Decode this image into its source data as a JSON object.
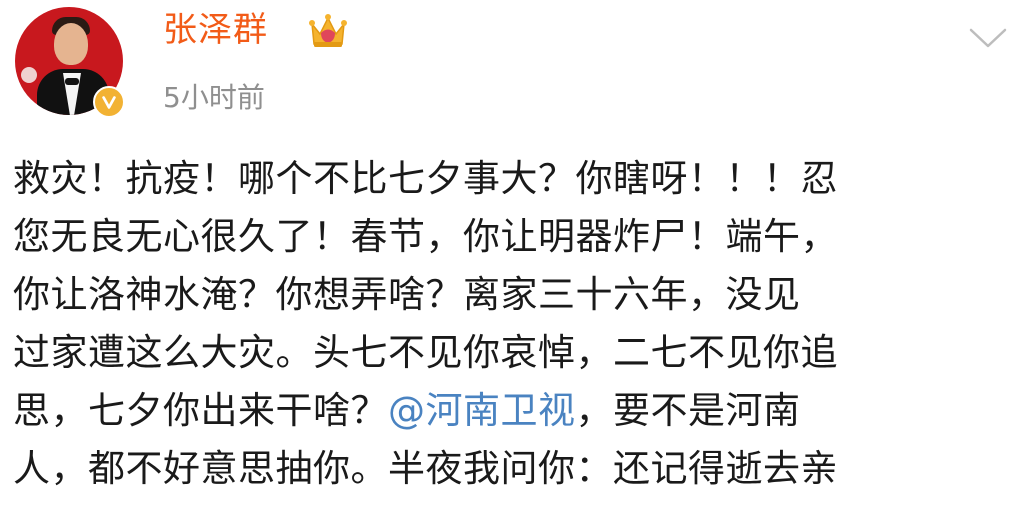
{
  "user": {
    "name": "张泽群",
    "timestamp": "5小时前",
    "verified_color": "#f2b233",
    "name_color": "#f25b18"
  },
  "icons": {
    "badge": "crown-icon",
    "verify": "verified-v-icon",
    "menu": "chevron-down-icon"
  },
  "post": {
    "lines": [
      "救灾！抗疫！哪个不比七夕事大？你瞎呀！！！忍",
      "您无良无心很久了！春节，你让明器炸尸！端午，",
      "你让洛神水淹？你想弄啥？离家三十六年，没见",
      "过家遭这么大灾。头七不见你哀悼，二七不见你追"
    ],
    "line5_before": "思，七夕你出来干啥？",
    "mention": "@河南卫视",
    "line5_after": "，要不是河南",
    "line6": "人，都不好意思抽你。半夜我问你：还记得逝去亲",
    "mention_color": "#4a83c1"
  }
}
